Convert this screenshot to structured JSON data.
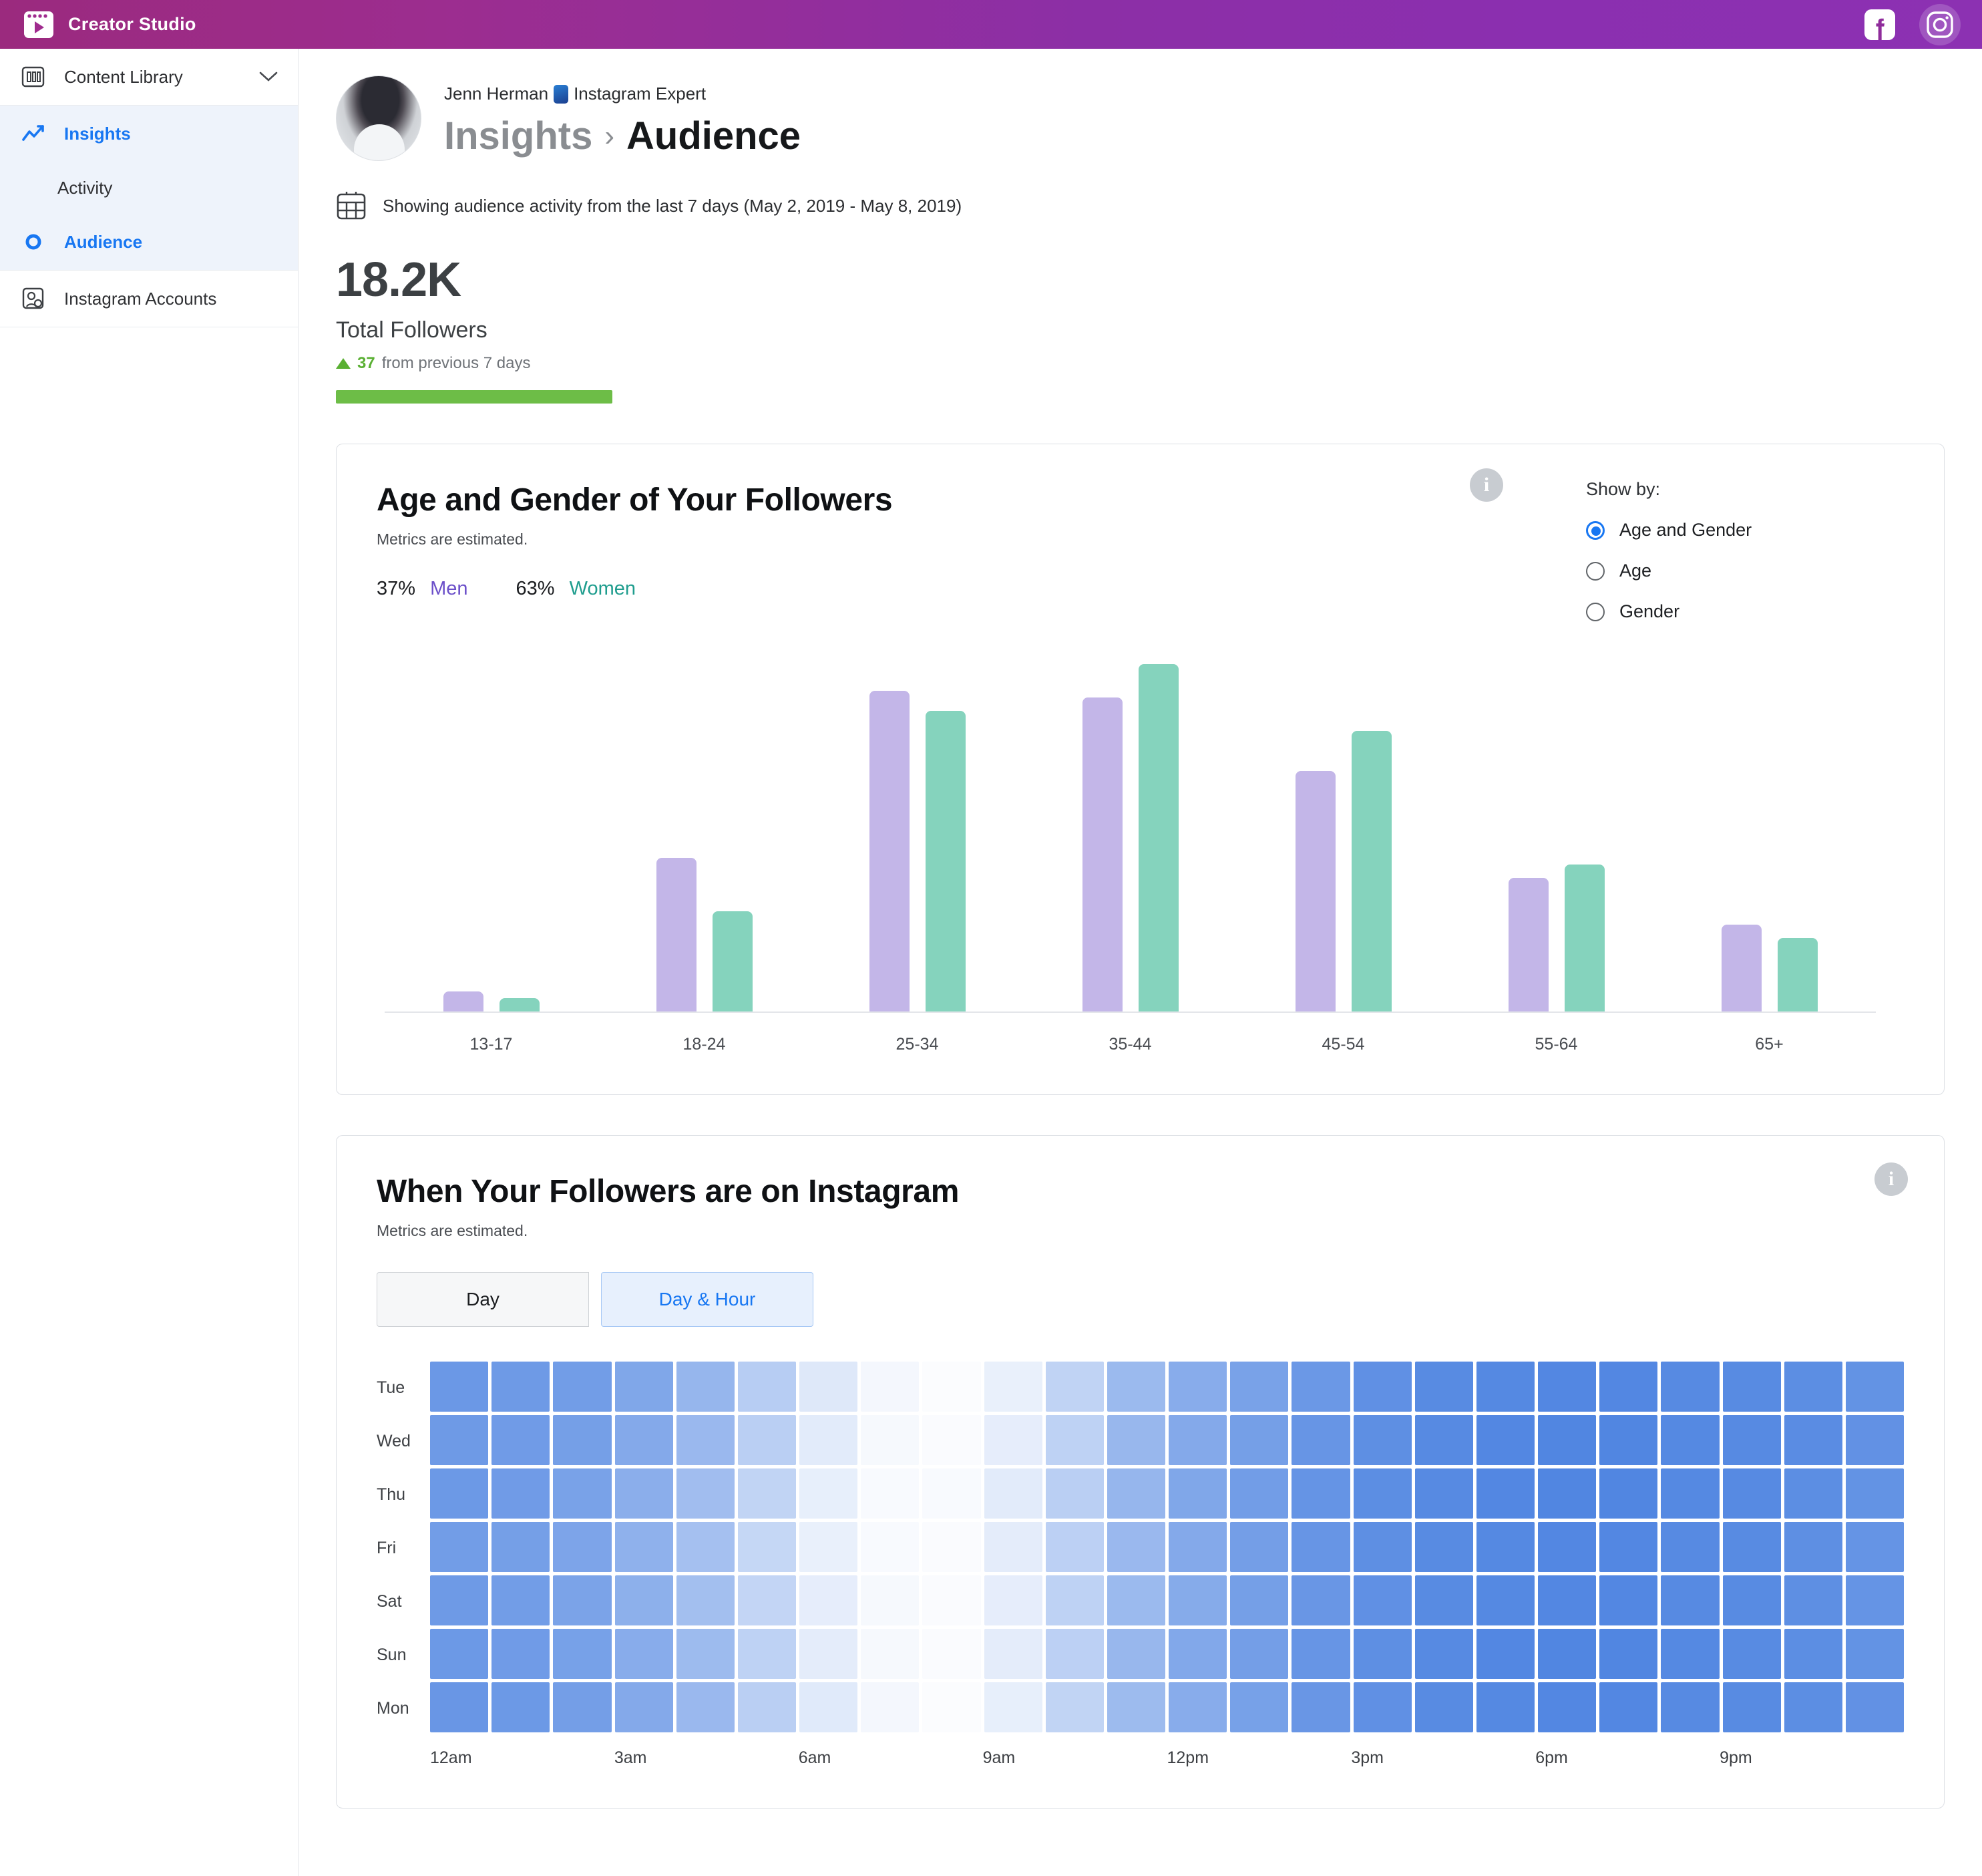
{
  "topbar": {
    "brand": "Creator Studio",
    "brand_icon": "creator-studio-icon",
    "facebook_icon": "facebook-icon",
    "instagram_icon": "instagram-icon",
    "bg_color": "#8f2c9b"
  },
  "sidebar": {
    "content_library": {
      "label": "Content Library",
      "icon": "library-icon",
      "chevron": "chevron-down-icon"
    },
    "insights": {
      "label": "Insights",
      "icon": "insights-chart-icon"
    },
    "activity": {
      "label": "Activity"
    },
    "audience": {
      "label": "Audience",
      "icon": "audience-circle-icon",
      "selected": true
    },
    "instagram_accounts": {
      "label": "Instagram Accounts",
      "icon": "instagram-account-icon"
    }
  },
  "header": {
    "account_name": "Jenn Herman",
    "account_name_suffix": "Instagram Expert",
    "breadcrumb_parent": "Insights",
    "breadcrumb_separator": "›",
    "breadcrumb_current": "Audience",
    "date_range_text": "Showing audience activity from the last 7 days (May 2, 2019 - May 8, 2019)",
    "calendar_icon": "calendar-icon"
  },
  "stat": {
    "value": "18.2K",
    "label": "Total Followers",
    "delta_arrow": "▲",
    "delta_value": "37",
    "delta_text": "from previous 7 days",
    "accent_color": "#6dbd47"
  },
  "age_card": {
    "title": "Age and Gender of Your Followers",
    "subtitle": "Metrics are estimated.",
    "info_icon": "info-icon",
    "legend": {
      "men_pct": "37%",
      "men_label": "Men",
      "women_pct": "63%",
      "women_label": "Women",
      "men_color": "#c3b6e8",
      "women_color": "#85d3bd"
    },
    "show_by": {
      "title": "Show by:",
      "options": [
        {
          "label": "Age and Gender",
          "selected": true
        },
        {
          "label": "Age",
          "selected": false
        },
        {
          "label": "Gender",
          "selected": false
        }
      ]
    }
  },
  "when_card": {
    "title": "When Your Followers are on Instagram",
    "subtitle": "Metrics are estimated.",
    "info_icon": "info-icon",
    "toggles": [
      {
        "label": "Day",
        "active": false
      },
      {
        "label": "Day & Hour",
        "active": true
      }
    ]
  },
  "chart_data": [
    {
      "type": "bar",
      "title": "Age and Gender of Your Followers",
      "xlabel": "",
      "ylabel": "",
      "grid": false,
      "legend_position": "top-left",
      "categories": [
        "13-17",
        "18-24",
        "25-34",
        "35-44",
        "45-54",
        "55-64",
        "65+"
      ],
      "series": [
        {
          "name": "Men",
          "color": "#c3b6e8",
          "values": [
            3,
            23,
            48,
            47,
            36,
            20,
            13
          ]
        },
        {
          "name": "Women",
          "color": "#85d3bd",
          "values": [
            2,
            15,
            45,
            52,
            42,
            22,
            11
          ]
        }
      ],
      "ylim": [
        0,
        55
      ]
    },
    {
      "type": "heatmap",
      "title": "When Your Followers are on Instagram",
      "xlabel": "",
      "ylabel": "",
      "rows": [
        "Tue",
        "Wed",
        "Thu",
        "Fri",
        "Sat",
        "Sun",
        "Mon"
      ],
      "hour_ticks": [
        "12am",
        "3am",
        "6am",
        "9am",
        "12pm",
        "3pm",
        "6pm",
        "9pm"
      ],
      "colorscale": [
        "#ffffff",
        "#4a81e0"
      ],
      "values": [
        [
          82,
          80,
          78,
          70,
          58,
          40,
          18,
          6,
          2,
          12,
          35,
          55,
          66,
          74,
          82,
          88,
          92,
          94,
          95,
          95,
          93,
          92,
          90,
          86
        ],
        [
          80,
          79,
          76,
          68,
          56,
          38,
          16,
          5,
          3,
          14,
          36,
          57,
          68,
          76,
          84,
          89,
          93,
          95,
          96,
          96,
          94,
          93,
          91,
          87
        ],
        [
          81,
          79,
          74,
          64,
          52,
          34,
          13,
          4,
          4,
          16,
          38,
          58,
          70,
          78,
          85,
          90,
          93,
          95,
          96,
          96,
          94,
          93,
          90,
          86
        ],
        [
          78,
          76,
          72,
          62,
          50,
          32,
          12,
          4,
          3,
          15,
          37,
          56,
          68,
          77,
          84,
          89,
          92,
          94,
          95,
          95,
          93,
          92,
          89,
          85
        ],
        [
          80,
          78,
          73,
          63,
          51,
          33,
          14,
          5,
          3,
          14,
          36,
          55,
          67,
          76,
          83,
          88,
          92,
          94,
          95,
          95,
          93,
          92,
          89,
          85
        ],
        [
          81,
          79,
          75,
          66,
          54,
          36,
          15,
          5,
          3,
          15,
          37,
          57,
          69,
          77,
          84,
          89,
          93,
          95,
          96,
          96,
          94,
          92,
          90,
          86
        ],
        [
          83,
          81,
          77,
          68,
          56,
          38,
          17,
          6,
          2,
          13,
          34,
          54,
          66,
          75,
          83,
          88,
          92,
          94,
          95,
          95,
          93,
          92,
          90,
          87
        ]
      ]
    }
  ]
}
